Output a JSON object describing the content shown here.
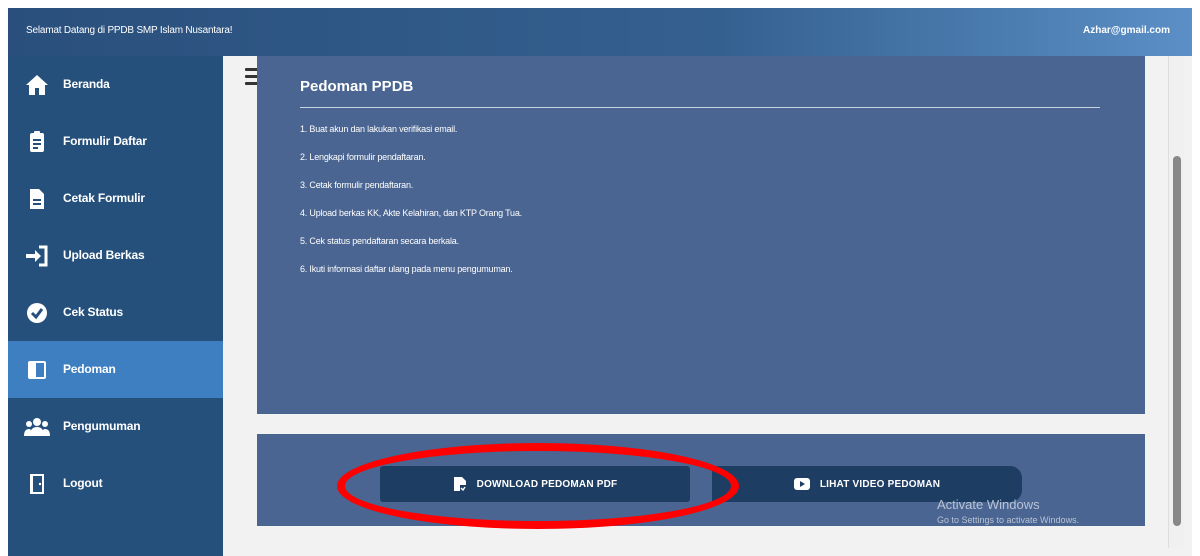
{
  "header": {
    "welcome": "Selamat Datang di PPDB SMP Islam Nusantara!",
    "email": "Azhar@gmail.com"
  },
  "sidebar": {
    "items": [
      {
        "label": "Beranda",
        "icon": "home-icon"
      },
      {
        "label": "Formulir Daftar",
        "icon": "clipboard-icon"
      },
      {
        "label": "Cetak Formulir",
        "icon": "document-icon"
      },
      {
        "label": "Upload Berkas",
        "icon": "sign-in-icon"
      },
      {
        "label": "Cek Status",
        "icon": "check-circle-icon"
      },
      {
        "label": "Pedoman",
        "icon": "book-icon",
        "active": true
      },
      {
        "label": "Pengumuman",
        "icon": "users-icon"
      },
      {
        "label": "Logout",
        "icon": "door-icon"
      }
    ]
  },
  "main": {
    "title": "Pedoman PPDB",
    "steps": [
      "1. Buat akun dan lakukan verifikasi email.",
      "2. Lengkapi formulir pendaftaran.",
      "3. Cetak formulir pendaftaran.",
      "4. Upload berkas KK, Akte Kelahiran, dan KTP Orang Tua.",
      "5. Cek status pendaftaran secara berkala.",
      "6. Ikuti informasi daftar ulang pada menu pengumuman."
    ],
    "download_label": "DOWNLOAD PEDOMAN PDF",
    "video_label": "LIHAT VIDEO PEDOMAN"
  },
  "watermark": {
    "title": "Activate Windows",
    "subtitle": "Go to Settings to activate Windows."
  },
  "colors": {
    "sidebar": "#26507c",
    "active": "#3e7fc1",
    "card": "#4a6591",
    "button": "#1e3d62",
    "highlight": "#ff0000"
  }
}
